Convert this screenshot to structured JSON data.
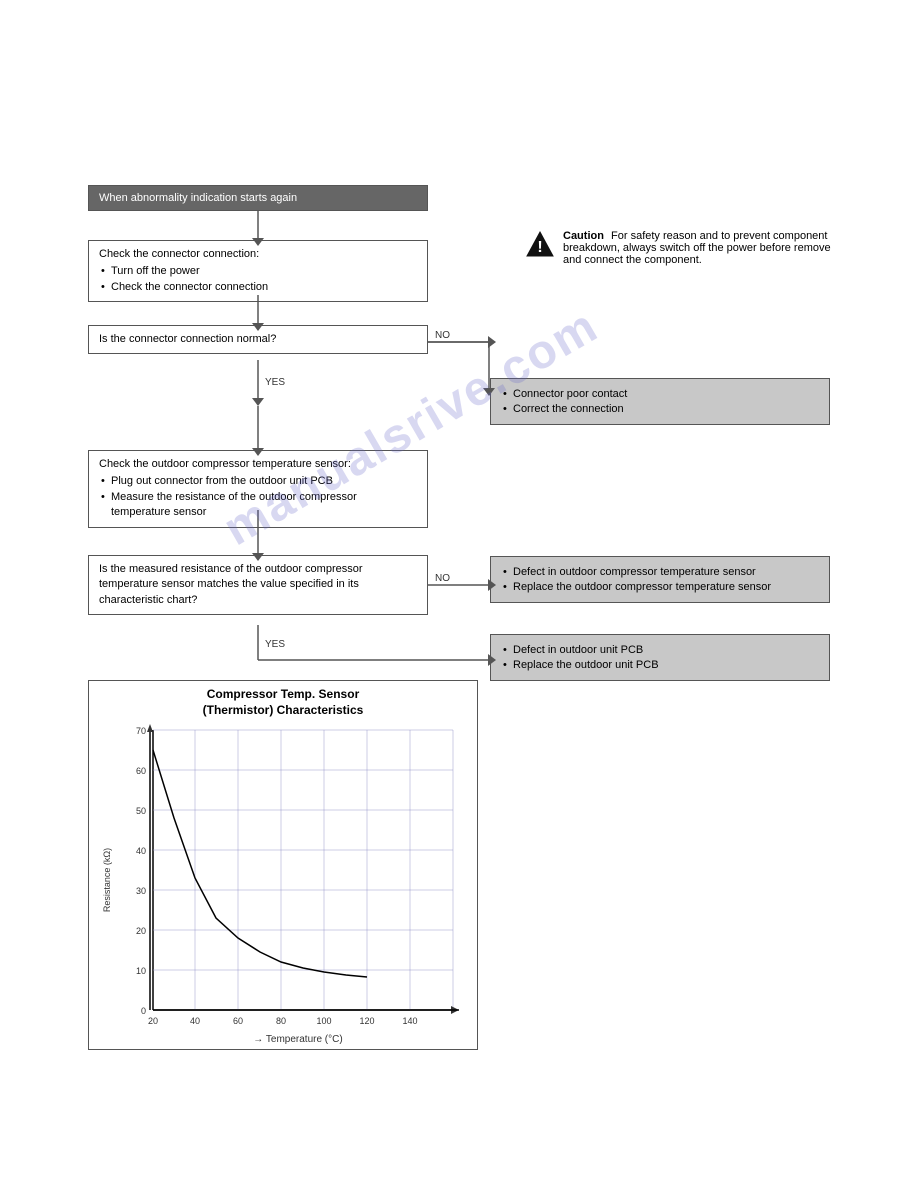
{
  "flowchart": {
    "start_box": "When abnormality indication starts again",
    "check_connector_box": {
      "title": "Check the connector connection:",
      "items": [
        "Turn off the power",
        "Check the connector connection"
      ]
    },
    "question1": "Is the connector connection normal?",
    "no_label": "NO",
    "yes_label": "YES",
    "right_box1": {
      "items": [
        "Connector poor contact",
        "Correct the connection"
      ]
    },
    "check_sensor_box": {
      "title": "Check the outdoor compressor temperature sensor:",
      "items": [
        "Plug out connector from the outdoor unit PCB",
        "Measure the resistance of the outdoor compressor temperature sensor"
      ]
    },
    "question2": "Is the measured resistance of the outdoor compressor temperature sensor matches the value specified in its characteristic chart?",
    "right_box2": {
      "items": [
        "Defect in outdoor compressor temperature sensor",
        "Replace the outdoor compressor temperature sensor"
      ]
    },
    "right_box3": {
      "items": [
        "Defect in outdoor unit PCB",
        "Replace the outdoor unit PCB"
      ]
    }
  },
  "caution": {
    "label": "Caution",
    "text": "For safety reason and to prevent component breakdown, always switch off the power before remove and connect the component."
  },
  "chart": {
    "title_line1": "Compressor Temp. Sensor",
    "title_line2": "(Thermistor) Characteristics",
    "y_axis_label": "Resistance (kΩ)",
    "x_axis_label": "Temperature (°C)",
    "y_ticks": [
      0,
      10,
      20,
      30,
      40,
      50,
      60,
      70
    ],
    "x_ticks": [
      20,
      40,
      60,
      80,
      100,
      120,
      140
    ]
  },
  "watermark": "manualsrive.com"
}
